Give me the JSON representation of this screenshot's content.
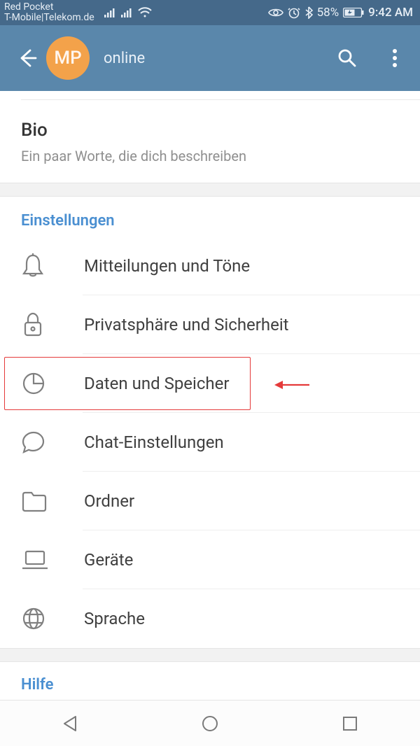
{
  "status_bar": {
    "carrier_line1": "Red Pocket",
    "carrier_line2": "T-Mobile|Telekom.de",
    "battery_text": "58%",
    "time": "9:42 AM"
  },
  "header": {
    "avatar_initials": "MP",
    "status_text": "online"
  },
  "bio": {
    "title": "Bio",
    "description": "Ein paar Worte, die dich beschreiben"
  },
  "sections": {
    "settings_title": "Einstellungen",
    "help_title": "Hilfe"
  },
  "settings": {
    "items": [
      {
        "icon": "bell-icon",
        "label": "Mitteilungen und Töne"
      },
      {
        "icon": "lock-icon",
        "label": "Privatsphäre und Sicherheit"
      },
      {
        "icon": "pie-icon",
        "label": "Daten und Speicher",
        "highlighted": true
      },
      {
        "icon": "chat-icon",
        "label": "Chat-Einstellungen"
      },
      {
        "icon": "folder-icon",
        "label": "Ordner"
      },
      {
        "icon": "laptop-icon",
        "label": "Geräte"
      },
      {
        "icon": "globe-icon",
        "label": "Sprache"
      }
    ]
  }
}
